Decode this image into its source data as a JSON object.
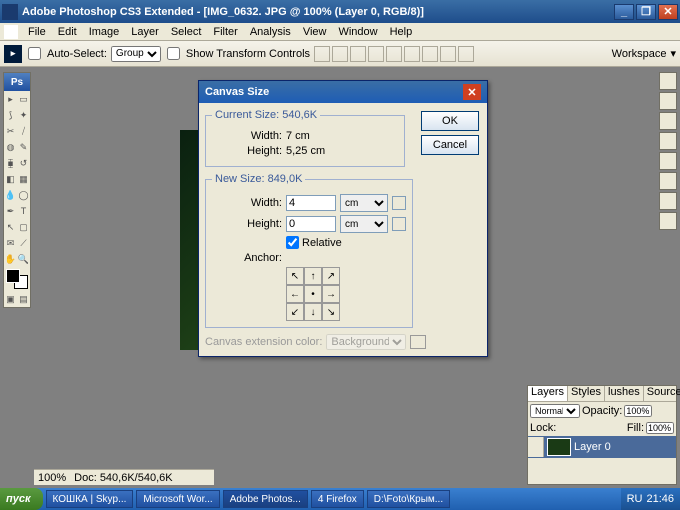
{
  "titlebar": {
    "title": "Adobe Photoshop CS3 Extended - [IMG_0632. JPG @ 100% (Layer 0, RGB/8)]"
  },
  "menu": [
    "File",
    "Edit",
    "Image",
    "Layer",
    "Select",
    "Filter",
    "Analysis",
    "View",
    "Window",
    "Help"
  ],
  "options": {
    "auto_select": "Auto-Select:",
    "auto_select_val": "Group",
    "show_transform": "Show Transform Controls",
    "workspace": "Workspace"
  },
  "dialog": {
    "title": "Canvas Size",
    "current_legend": "Current Size: 540,6K",
    "cur_width_lbl": "Width:",
    "cur_width_val": "7 cm",
    "cur_height_lbl": "Height:",
    "cur_height_val": "5,25 cm",
    "new_legend": "New Size: 849,0K",
    "new_width_lbl": "Width:",
    "new_width_val": "4",
    "new_height_lbl": "Height:",
    "new_height_val": "0",
    "unit": "cm",
    "relative": "Relative",
    "anchor": "Anchor:",
    "ext_color": "Canvas extension color:",
    "ext_color_val": "Background",
    "ok": "OK",
    "cancel": "Cancel"
  },
  "layers": {
    "tabs": [
      "Layers",
      "Styles",
      "lushes",
      "Source"
    ],
    "blend": "Normal",
    "opacity_lbl": "Opacity:",
    "opacity_val": "100%",
    "lock_lbl": "Lock:",
    "fill_lbl": "Fill:",
    "fill_val": "100%",
    "layer_name": "Layer 0"
  },
  "status": {
    "zoom": "100%",
    "doc": "Doc: 540,6K/540,6K"
  },
  "taskbar": {
    "start": "пуск",
    "tasks": [
      {
        "label": "КОШКА | Skyp..."
      },
      {
        "label": "Microsoft Wor..."
      },
      {
        "label": "Adobe Photos...",
        "active": true
      },
      {
        "label": "4 Firefox"
      },
      {
        "label": "D:\\Foto\\Крым..."
      }
    ],
    "lang": "RU",
    "time": "21:46"
  }
}
